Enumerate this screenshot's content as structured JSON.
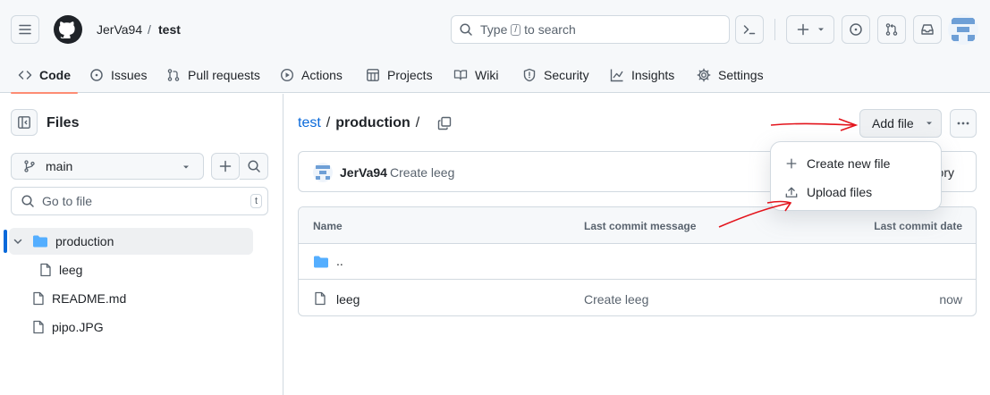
{
  "header": {
    "owner": "JerVa94",
    "separator": "/",
    "repo": "test",
    "search": {
      "prefix": "Type",
      "key": "/",
      "suffix": "to search"
    }
  },
  "nav": {
    "tabs": [
      {
        "label": "Code",
        "icon": "code-icon"
      },
      {
        "label": "Issues",
        "icon": "issue-icon"
      },
      {
        "label": "Pull requests",
        "icon": "pull-request-icon"
      },
      {
        "label": "Actions",
        "icon": "play-icon"
      },
      {
        "label": "Projects",
        "icon": "table-icon"
      },
      {
        "label": "Wiki",
        "icon": "book-icon"
      },
      {
        "label": "Security",
        "icon": "shield-icon"
      },
      {
        "label": "Insights",
        "icon": "graph-icon"
      },
      {
        "label": "Settings",
        "icon": "gear-icon"
      }
    ]
  },
  "sidebar": {
    "title": "Files",
    "branch": "main",
    "go_to_file_placeholder": "Go to file",
    "go_to_file_key": "t",
    "tree": [
      {
        "name": "production",
        "type": "folder"
      },
      {
        "name": "leeg",
        "type": "file"
      },
      {
        "name": "README.md",
        "type": "file"
      },
      {
        "name": "pipo.JPG",
        "type": "file"
      }
    ]
  },
  "main": {
    "path": {
      "root": "test",
      "sep1": "/",
      "folder": "production",
      "sep2": "/"
    },
    "add_file_label": "Add file",
    "commit": {
      "user": "JerVa94",
      "message": "Create leeg",
      "history_partial": "ory"
    },
    "table": {
      "headers": {
        "name": "Name",
        "message": "Last commit message",
        "date": "Last commit date"
      },
      "rows": [
        {
          "name": "..",
          "message": "",
          "date": ""
        },
        {
          "name": "leeg",
          "message": "Create leeg",
          "date": "now"
        }
      ]
    }
  },
  "dropdown": {
    "items": [
      {
        "label": "Create new file",
        "icon": "plus-icon"
      },
      {
        "label": "Upload files",
        "icon": "upload-icon"
      }
    ]
  },
  "colors": {
    "accent": "#0969da",
    "folder": "#54aeff",
    "annotation": "#e3141c",
    "tab_underline": "#fd8c73"
  }
}
